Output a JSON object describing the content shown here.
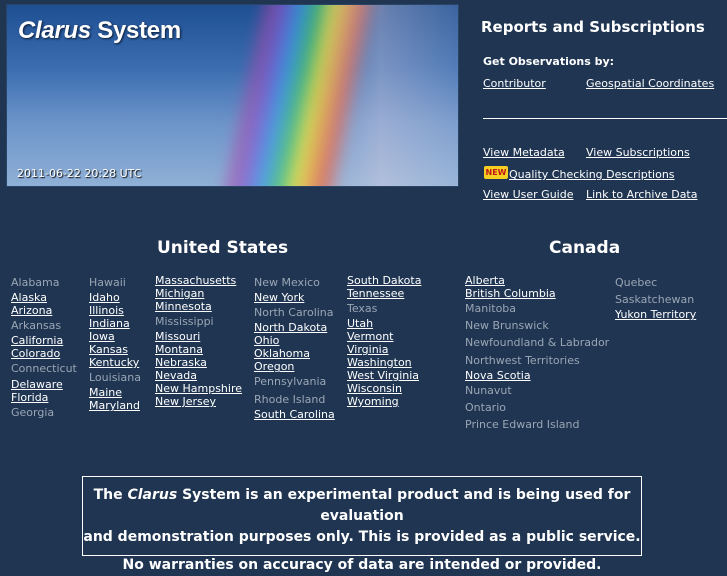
{
  "banner": {
    "title_word1": "Clarus",
    "title_word2": "System",
    "timestamp": "2011-06-22 20:28 UTC"
  },
  "reports": {
    "title": "Reports and Subscriptions",
    "observations_label": "Get Observations by:",
    "contributor": "Contributor",
    "geospatial": "Geospatial Coordinates",
    "view_metadata": "View Metadata",
    "view_subscriptions": "View Subscriptions",
    "new_badge": "NEW",
    "quality_checking": "Quality Checking Descriptions",
    "view_user_guide": "View User Guide",
    "archive_link": "Link to Archive Data"
  },
  "us": {
    "title": "United States",
    "columns": [
      [
        {
          "name": "Alabama",
          "active": false
        },
        {
          "name": "Alaska",
          "active": true
        },
        {
          "name": "Arizona",
          "active": true
        },
        {
          "name": "Arkansas",
          "active": false
        },
        {
          "name": "California",
          "active": true
        },
        {
          "name": "Colorado",
          "active": true
        },
        {
          "name": "Connecticut",
          "active": false
        },
        {
          "name": "Delaware",
          "active": true
        },
        {
          "name": "Florida",
          "active": true
        },
        {
          "name": "Georgia",
          "active": false
        }
      ],
      [
        {
          "name": "Hawaii",
          "active": false
        },
        {
          "name": "Idaho",
          "active": true
        },
        {
          "name": "Illinois",
          "active": true
        },
        {
          "name": "Indiana",
          "active": true
        },
        {
          "name": "Iowa",
          "active": true
        },
        {
          "name": "Kansas",
          "active": true
        },
        {
          "name": "Kentucky",
          "active": true
        },
        {
          "name": "Louisiana",
          "active": false
        },
        {
          "name": "Maine",
          "active": true
        },
        {
          "name": "Maryland",
          "active": true
        }
      ],
      [
        {
          "name": "Massachusetts",
          "active": true
        },
        {
          "name": "Michigan",
          "active": true
        },
        {
          "name": "Minnesota",
          "active": true
        },
        {
          "name": "Mississippi",
          "active": false
        },
        {
          "name": "Missouri",
          "active": true
        },
        {
          "name": "Montana",
          "active": true
        },
        {
          "name": "Nebraska",
          "active": true
        },
        {
          "name": "Nevada",
          "active": true
        },
        {
          "name": "New Hampshire",
          "active": true
        },
        {
          "name": "New Jersey",
          "active": true
        }
      ],
      [
        {
          "name": "New Mexico",
          "active": false
        },
        {
          "name": "New York",
          "active": true
        },
        {
          "name": "North Carolina",
          "active": false
        },
        {
          "name": "North Dakota",
          "active": true
        },
        {
          "name": "Ohio",
          "active": true
        },
        {
          "name": "Oklahoma",
          "active": true
        },
        {
          "name": "Oregon",
          "active": true
        },
        {
          "name": "Pennsylvania",
          "active": false
        },
        {
          "name": "Rhode Island",
          "active": false
        },
        {
          "name": "South Carolina",
          "active": true
        }
      ],
      [
        {
          "name": "South Dakota",
          "active": true
        },
        {
          "name": "Tennessee",
          "active": true
        },
        {
          "name": "Texas",
          "active": false
        },
        {
          "name": "Utah",
          "active": true
        },
        {
          "name": "Vermont",
          "active": true
        },
        {
          "name": "Virginia",
          "active": true
        },
        {
          "name": "Washington",
          "active": true
        },
        {
          "name": "West Virginia",
          "active": true
        },
        {
          "name": "Wisconsin",
          "active": true
        },
        {
          "name": "Wyoming",
          "active": true
        }
      ]
    ]
  },
  "canada": {
    "title": "Canada",
    "columns": [
      [
        {
          "name": "Alberta",
          "active": true
        },
        {
          "name": "British Columbia",
          "active": true
        },
        {
          "name": "Manitoba",
          "active": false
        },
        {
          "name": "New Brunswick",
          "active": false
        },
        {
          "name": "Newfoundland & Labrador",
          "active": false
        },
        {
          "name": "Northwest Territories",
          "active": false
        },
        {
          "name": "Nova Scotia",
          "active": true
        },
        {
          "name": "Nunavut",
          "active": false
        },
        {
          "name": "Ontario",
          "active": false
        },
        {
          "name": "Prince Edward Island",
          "active": false
        }
      ],
      [
        {
          "name": "Quebec",
          "active": false
        },
        {
          "name": "Saskatchewan",
          "active": false
        },
        {
          "name": "Yukon Territory",
          "active": true
        }
      ]
    ]
  },
  "disclaimer": {
    "line1_pre": "The",
    "line1_italic": "Clarus",
    "line1_post": "System is an experimental product and is being used for evaluation",
    "line2": "and demonstration purposes only.  This is provided as a public service.",
    "line3": "No warranties on accuracy of data are intended or provided."
  },
  "colors": {
    "background": "#1f3552",
    "inactive_text": "#9aa6b4"
  }
}
